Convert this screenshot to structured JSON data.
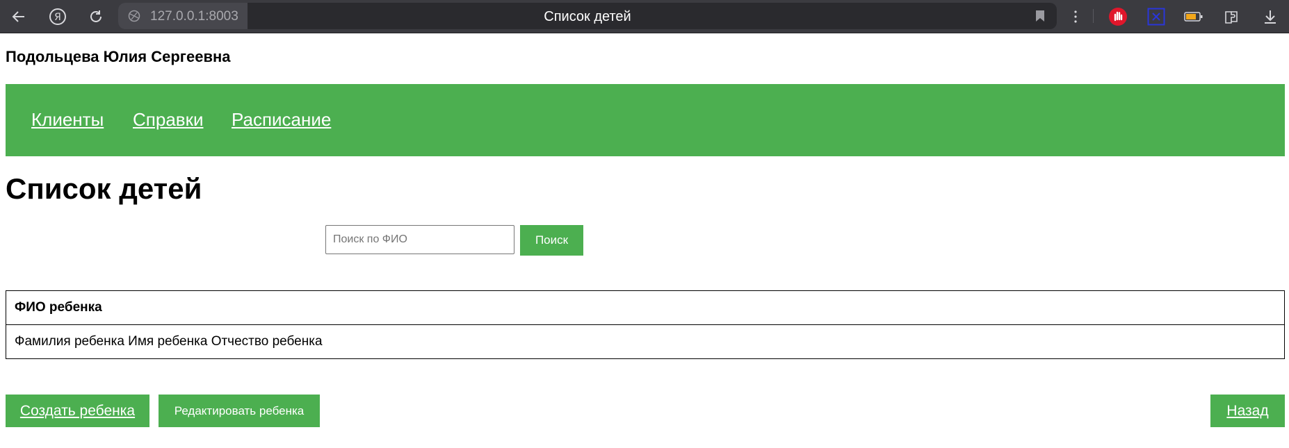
{
  "browser": {
    "url": "127.0.0.1:8003",
    "tab_title": "Список детей",
    "icons": [
      "back-arrow-icon",
      "yandex-icon",
      "reload-icon",
      "globe-icon",
      "bookmark-icon",
      "more-icon",
      "stop-hand-icon",
      "close-square-icon",
      "battery-icon",
      "extensions-icon",
      "download-icon"
    ]
  },
  "header": {
    "user_name": "Подольцева Юлия Сергеевна"
  },
  "nav": {
    "background": "#4caf50",
    "items": [
      {
        "label": "Клиенты"
      },
      {
        "label": "Справки"
      },
      {
        "label": "Расписание"
      }
    ]
  },
  "main": {
    "title": "Список детей",
    "search": {
      "placeholder": "Поиск по ФИО",
      "value": "",
      "button_label": "Поиск"
    },
    "table": {
      "columns": [
        "ФИО ребенка"
      ],
      "rows": [
        [
          "Фамилия ребенка Имя ребенка Отчество ребенка"
        ]
      ]
    },
    "actions": {
      "create_label": "Создать ребенка",
      "edit_label": "Редактировать ребенка",
      "back_label": "Назад"
    }
  },
  "colors": {
    "accent": "#4caf50",
    "chrome": "#3b3b40"
  }
}
